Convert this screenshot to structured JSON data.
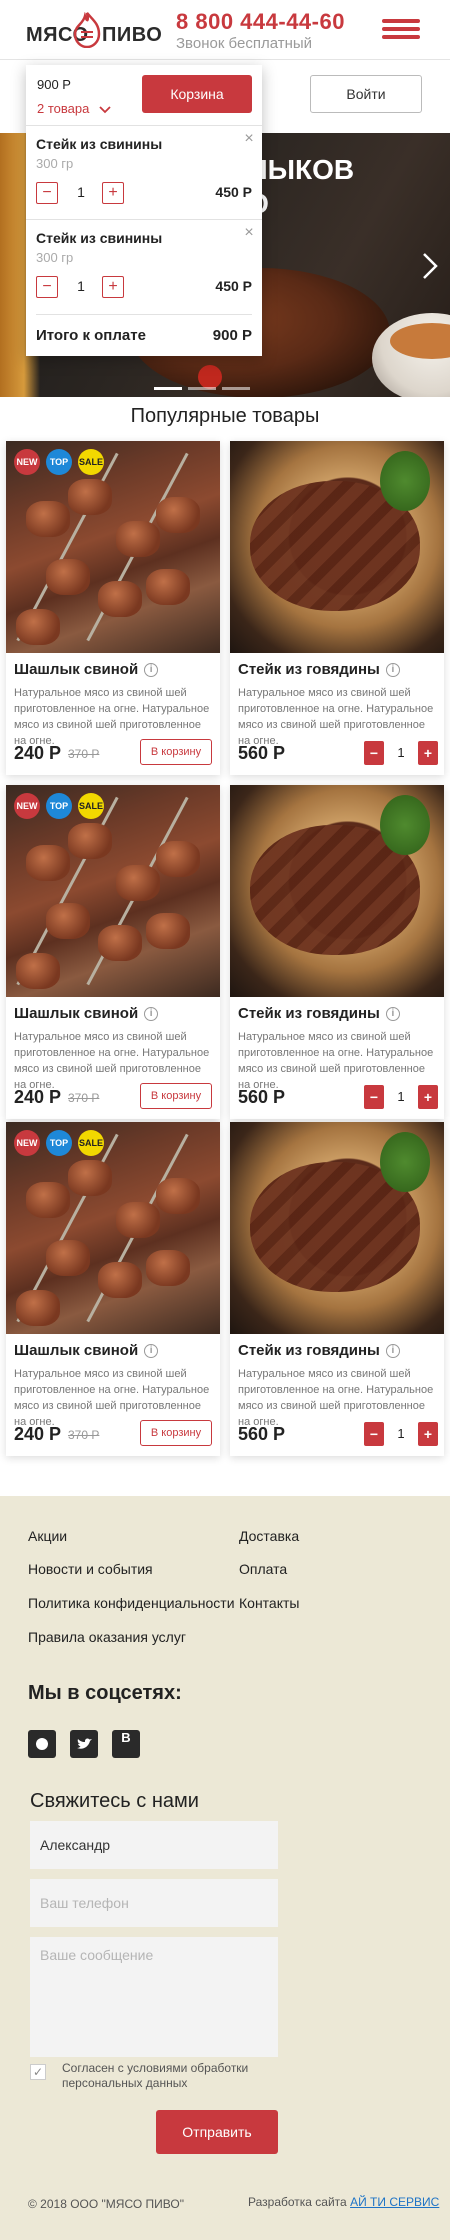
{
  "header": {
    "logo_left": "МЯСО",
    "logo_right": "ПИВО",
    "phone": "8 800 444-44-60",
    "phone_note": "Звонок бесплатный"
  },
  "account": {
    "login_label": "Войти"
  },
  "hero": {
    "heading_1": "ЛЫКОВ",
    "heading_2": "Ю"
  },
  "cart": {
    "total": "900 Р",
    "count": "2 товара",
    "button": "Корзина",
    "items": [
      {
        "name": "Стейк из свинины",
        "weight": "300 гр",
        "qty": "1",
        "price": "450 Р"
      },
      {
        "name": "Стейк из свинины",
        "weight": "300 гр",
        "qty": "1",
        "price": "450 Р"
      }
    ],
    "sum_label": "Итого к оплате",
    "sum_value": "900 Р"
  },
  "popular": {
    "title": "Популярные товары",
    "badges": {
      "new": "NEW",
      "top": "TOP",
      "sale": "SALE"
    },
    "kebab": {
      "name": "Шашлык свиной",
      "desc": "Натуральное мясо из свиной шей приготовленное на огне. Натуральное мясо из свиной шей приготовленное на огне.",
      "price": "240 Р",
      "old_price": "370 Р",
      "add_label": "В корзину"
    },
    "steak": {
      "name": "Стейк из говядины",
      "desc": "Натуральное мясо из свиной шей приготовленное на огне. Натуральное мясо из свиной шей приготовленное на огне.",
      "price": "560 Р",
      "qty": "1"
    }
  },
  "footer": {
    "links": [
      "Акции",
      "Новости и события",
      "Политика конфиденциальности",
      "Правила оказания услуг",
      "Доставка",
      "Оплата",
      "Контакты"
    ],
    "social_title": "Мы в соцсетях:",
    "social_icons": [
      "instagram-icon",
      "twitter-icon",
      "vk-icon"
    ],
    "contact_title": "Свяжитесь с нами",
    "name_value": "Александр",
    "phone_placeholder": "Ваш телефон",
    "message_placeholder": "Ваше сообщение",
    "consent": "Согласен с условиями обработки персональных данных",
    "send_label": "Отправить",
    "copyright": "© 2018 ООО \"МЯСО ПИВО\"",
    "dev_prefix": "Разработка сайта",
    "dev_link": "АЙ ТИ СЕРВИС"
  },
  "colors": {
    "accent": "#c8393e",
    "footer_bg": "#ece8d6",
    "badge_top": "#1e88d8",
    "badge_sale": "#f2d800"
  }
}
